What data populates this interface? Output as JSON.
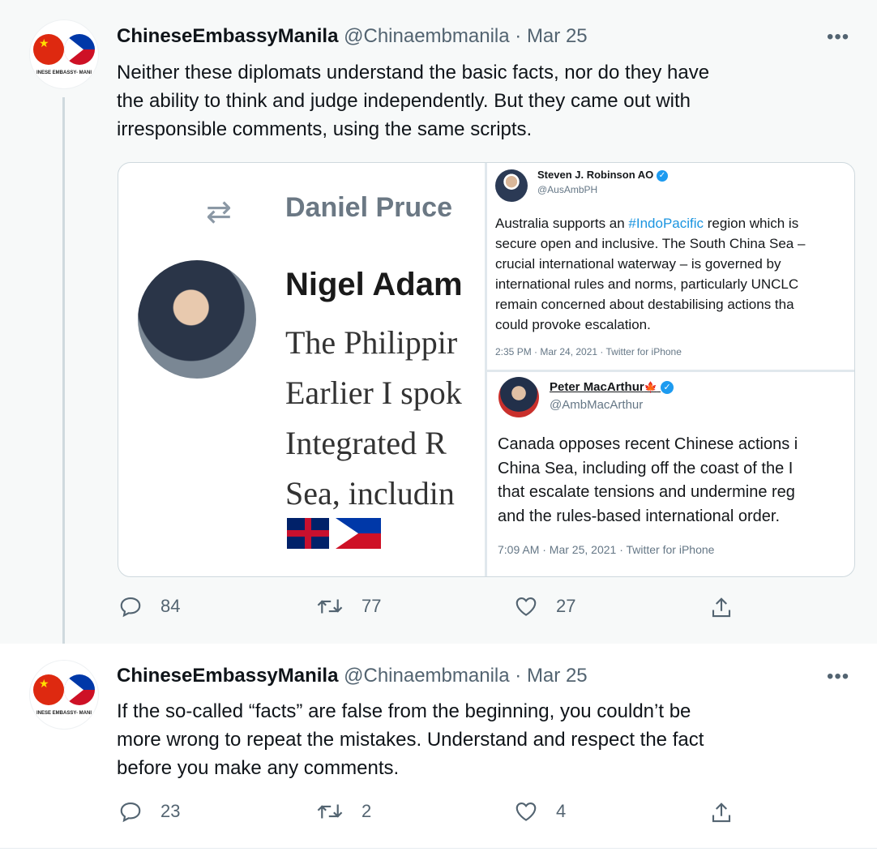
{
  "tweet1": {
    "display_name": "ChineseEmbassyManila",
    "handle": "@Chinaembmanila",
    "separator": "·",
    "date": "Mar 25",
    "more": "•••",
    "avatar_text": "INESE EMBASSY- MANI",
    "lines": [
      "Neither these diplomats understand the basic facts, nor do they have",
      "the ability to think and judge independently. But they came out with",
      "irresponsible comments, using the same scripts."
    ],
    "embed_left": {
      "retweeter": "Daniel Pruce",
      "name": "Nigel Adam",
      "lines": [
        "The Philippir",
        "Earlier I spok",
        "Integrated R",
        "Sea, includin"
      ]
    },
    "embed_right_top": {
      "name": "Steven J. Robinson AO",
      "handle": "@AusAmbPH",
      "text_pre": "Australia supports an ",
      "hashtag": "#IndoPacific",
      "text_post": " region which is",
      "lines": [
        "secure open and inclusive. The South China Sea –",
        "crucial international waterway – is governed by",
        "international rules and norms, particularly UNCLC",
        "remain concerned about destabilising actions tha",
        "could provoke escalation."
      ],
      "meta": "2:35 PM · Mar 24, 2021 · Twitter for iPhone"
    },
    "embed_right_bottom": {
      "name": "Peter MacArthur",
      "handle": "@AmbMacArthur",
      "lines": [
        "Canada opposes recent Chinese actions i",
        "China Sea, including off the coast of the I",
        "that escalate tensions and undermine reg",
        "and the rules-based international order."
      ],
      "meta": "7:09 AM · Mar 25, 2021 · Twitter for iPhone"
    },
    "actions": {
      "replies": "84",
      "retweets": "77",
      "likes": "27"
    }
  },
  "tweet2": {
    "display_name": "ChineseEmbassyManila",
    "handle": "@Chinaembmanila",
    "separator": "·",
    "date": "Mar 25",
    "more": "•••",
    "avatar_text": "INESE EMBASSY- MANI",
    "lines": [
      "If the so-called “facts” are false from the beginning, you couldn’t be",
      "more wrong to repeat the mistakes. Understand and respect the fact",
      "before you make any comments."
    ],
    "actions": {
      "replies": "23",
      "retweets": "2",
      "likes": "4"
    }
  },
  "colors": {
    "accent": "#1d9bf0",
    "muted": "#536471",
    "thread_line": "#cfd9de",
    "highlight_bg": "#f7f9f9"
  },
  "icons": [
    "reply-icon",
    "retweet-icon",
    "like-icon",
    "share-icon",
    "verified-icon",
    "more-icon"
  ]
}
